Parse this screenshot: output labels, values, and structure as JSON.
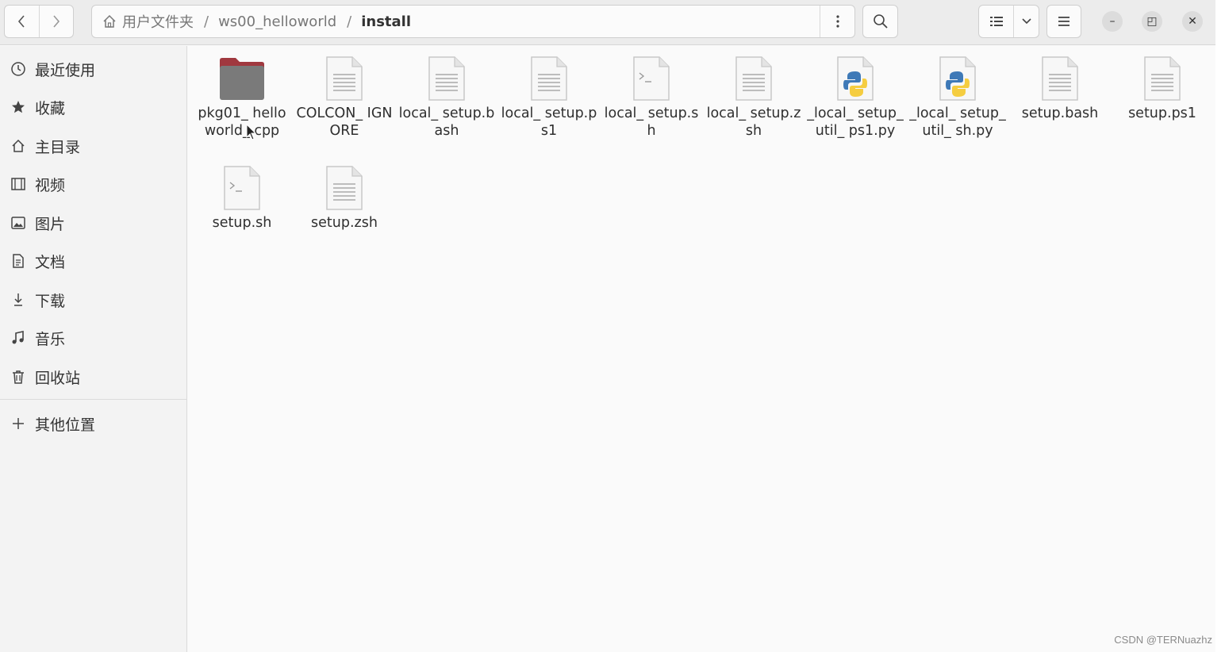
{
  "header": {
    "back_icon": "chevron-left-icon",
    "forward_icon": "chevron-right-icon",
    "breadcrumbs": [
      {
        "label": "用户文件夹",
        "icon": "home-icon"
      },
      {
        "label": "ws00_helloworld"
      },
      {
        "label": "install"
      }
    ],
    "separator": "/",
    "path_menu_icon": "vertical-dots-icon",
    "search_icon": "search-icon",
    "view_list_icon": "list-view-icon",
    "view_dropdown_icon": "chevron-down-icon",
    "main_menu_icon": "hamburger-icon",
    "window_controls": {
      "minimize": "–",
      "maximize": "◰",
      "close": "✕"
    }
  },
  "sidebar": {
    "items": [
      {
        "label": "最近使用",
        "icon": "clock-icon"
      },
      {
        "label": "收藏",
        "icon": "star-icon"
      },
      {
        "label": "主目录",
        "icon": "home-icon"
      },
      {
        "label": "视频",
        "icon": "film-icon"
      },
      {
        "label": "图片",
        "icon": "image-icon"
      },
      {
        "label": "文档",
        "icon": "document-icon"
      },
      {
        "label": "下载",
        "icon": "download-icon"
      },
      {
        "label": "音乐",
        "icon": "music-icon"
      },
      {
        "label": "回收站",
        "icon": "trash-icon"
      }
    ],
    "other_locations": {
      "label": "其他位置",
      "icon": "plus-icon"
    }
  },
  "files": [
    {
      "name": "pkg01_ helloworld_ cpp",
      "kind": "folder"
    },
    {
      "name": "COLCON_ IGNORE",
      "kind": "text"
    },
    {
      "name": "local_ setup.bash",
      "kind": "text"
    },
    {
      "name": "local_ setup.ps1",
      "kind": "text"
    },
    {
      "name": "local_ setup.sh",
      "kind": "script"
    },
    {
      "name": "local_ setup.zsh",
      "kind": "text"
    },
    {
      "name": "_local_ setup_util_ ps1.py",
      "kind": "python"
    },
    {
      "name": "_local_ setup_util_ sh.py",
      "kind": "python"
    },
    {
      "name": "setup.bash",
      "kind": "text"
    },
    {
      "name": "setup.ps1",
      "kind": "text"
    },
    {
      "name": "setup.sh",
      "kind": "script"
    },
    {
      "name": "setup.zsh",
      "kind": "text"
    }
  ],
  "watermark": "CSDN @TERNuazhz",
  "colors": {
    "folder": "#a0383f",
    "folder_body": "#7a7a7a",
    "python_blue": "#3e79b7",
    "python_yellow": "#f5cd40"
  }
}
